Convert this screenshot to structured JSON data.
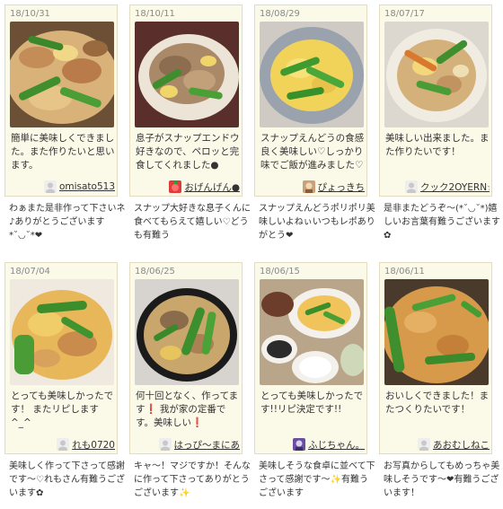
{
  "reports": [
    {
      "date": "18/10/31",
      "message": "簡単に美味しくできました。また作りたいと思います。",
      "user": "omisato513",
      "reply": "わぁまた是非作って下さいネ♪ありがとうございます*˘◡˘*❤"
    },
    {
      "date": "18/10/11",
      "message": "息子がスナップエンドウ好きなので、ペロッと完食してくれました●",
      "user": "おげんげん●",
      "reply": "スナップ大好きな息子くんに食べてもらえて嬉しい♡どうも有難う"
    },
    {
      "date": "18/08/29",
      "message": "スナップえんどうの食感良く美味しい♡しっかり味でご飯が進みました♡",
      "user": "ぴょっきち",
      "reply": "スナップえんどうポリポリ美味しいよねぃいつもレポありがとう❤"
    },
    {
      "date": "18/07/17",
      "message": "美味しい出来ました。また作りたいです！",
      "user": "クック2OYERN☆",
      "reply": "是非またどうぞ〜(*˘◡˘*)嬉しいお言葉有難うございます✿"
    },
    {
      "date": "18/07/04",
      "message": "とっても美味しかったです！ またリピします^_^",
      "user": "れも0720",
      "reply": "美味しく作って下さって感謝です〜♡れもさん有難うございます✿"
    },
    {
      "date": "18/06/25",
      "message": "何十回となく、作ってます❗ 我が家の定番です。美味しい❗",
      "user": "はっぴ〜まにあ",
      "reply": "キャ〜！マジですか！そんなに作って下さってありがとうございます✨"
    },
    {
      "date": "18/06/15",
      "message": "とっても美味しかったです!!リピ決定です!!",
      "user": "ふじちゃん。",
      "reply": "美味しそうな食卓に並べて下さって感謝です〜✨有難うございます"
    },
    {
      "date": "18/06/11",
      "message": "おいしくできました！またつくりたいです！",
      "user": "あおむしねこ",
      "reply": "お写真からしてもめっちゃ美味しそうです〜❤有難うございます！"
    }
  ],
  "colors": {
    "card_bg": "#fbf9e8",
    "card_border": "#e3dcc0",
    "text": "#333333",
    "date": "#8a8a8a"
  }
}
